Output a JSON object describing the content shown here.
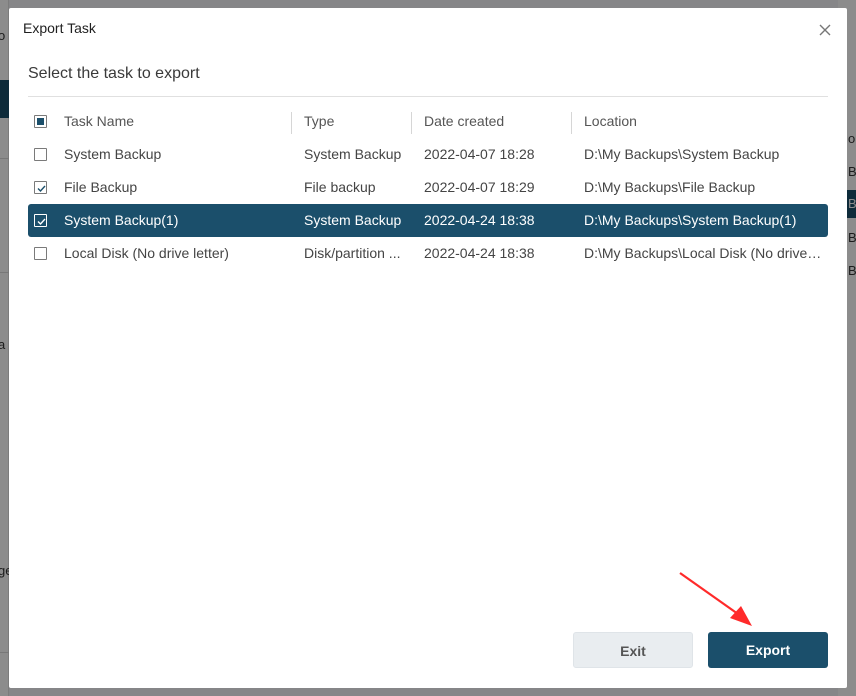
{
  "background": {
    "left_fragments": [
      "o",
      "a",
      "ge"
    ],
    "right_fragments": [
      "on",
      "B",
      "B",
      "B",
      "B"
    ]
  },
  "dialog": {
    "title": "Export Task",
    "close_icon": "close-icon",
    "subtitle": "Select the task to export",
    "columns": [
      "Task Name",
      "Type",
      "Date created",
      "Location"
    ],
    "rows": [
      {
        "name": "System Backup",
        "type": "System Backup",
        "date": "2022-04-07 18:28",
        "location": "D:\\My Backups\\System Backup",
        "checked": false,
        "selected": false
      },
      {
        "name": "File Backup",
        "type": "File backup",
        "date": "2022-04-07 18:29",
        "location": "D:\\My Backups\\File Backup",
        "checked": true,
        "selected": false
      },
      {
        "name": "System Backup(1)",
        "type": "System Backup",
        "date": "2022-04-24 18:38",
        "location": "D:\\My Backups\\System Backup(1)",
        "checked": true,
        "selected": true
      },
      {
        "name": "Local Disk (No drive letter)",
        "type": "Disk/partition ...",
        "date": "2022-04-24 18:38",
        "location": "D:\\My Backups\\Local Disk (No drive l...",
        "checked": false,
        "selected": false
      }
    ],
    "header_checkbox_state": "partial",
    "buttons": {
      "exit": "Exit",
      "export": "Export"
    }
  },
  "colors": {
    "accent": "#1b4f6b",
    "annotation_arrow": "#ff2a2a"
  }
}
